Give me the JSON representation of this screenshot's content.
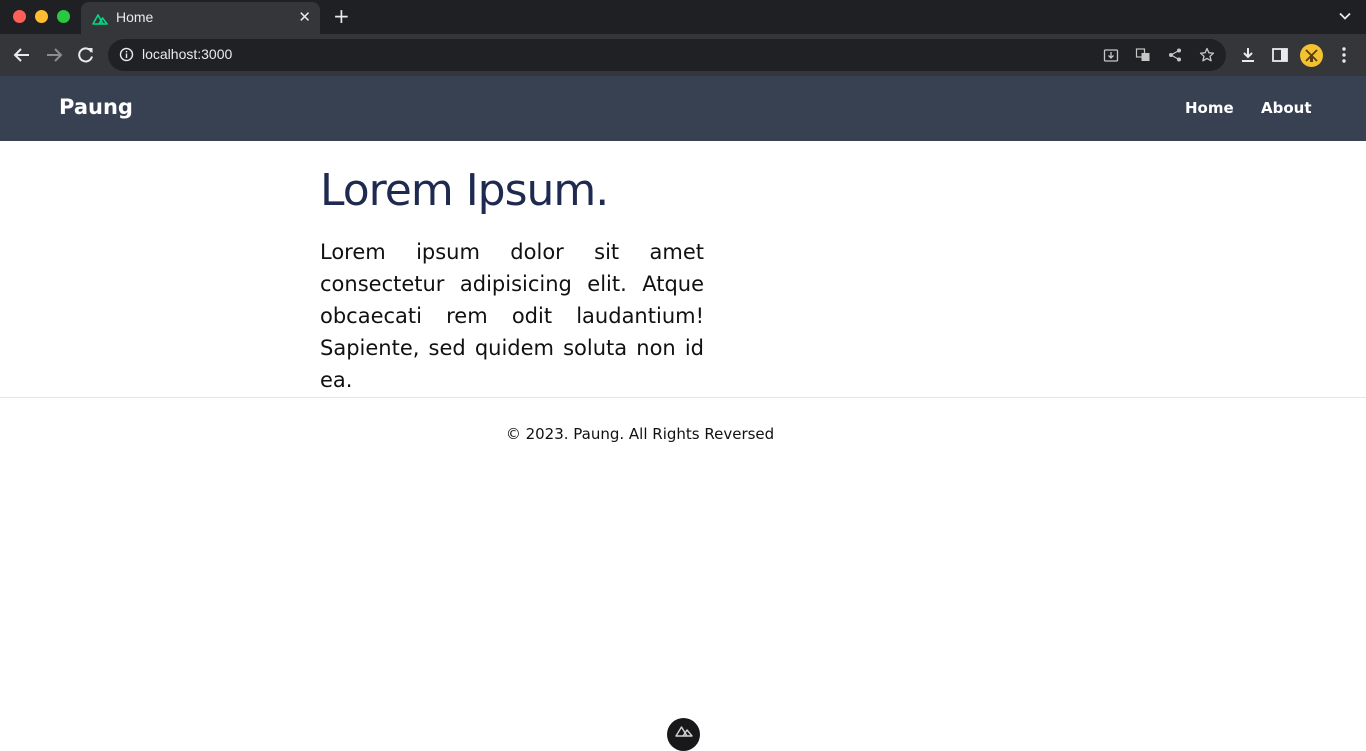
{
  "browser": {
    "tab": {
      "title": "Home",
      "favicon": "nuxt-logo-icon",
      "close_glyph": "✕"
    },
    "new_tab_glyph": "+",
    "address_bar": {
      "url": "localhost:3000"
    },
    "toolbar_icons": [
      "back-arrow-icon",
      "forward-arrow-icon",
      "reload-icon",
      "site-info-icon",
      "install-app-icon",
      "translate-icon",
      "share-icon",
      "bookmark-star-icon",
      "downloads-icon",
      "side-panel-icon",
      "profile-avatar",
      "kebab-menu-icon"
    ]
  },
  "site": {
    "brand": "Paung",
    "nav": [
      {
        "label": "Home"
      },
      {
        "label": "About"
      }
    ],
    "colors": {
      "navbar": "#374151",
      "heading": "#1e2a4f"
    }
  },
  "main": {
    "heading": "Lorem Ipsum.",
    "paragraph": "Lorem ipsum dolor sit amet consectetur adipisicing elit. Atque obcaecati rem odit laudantium! Sapiente, sed quidem soluta non id ea."
  },
  "footer": {
    "text": "© 2023. Paung. All Rights Reversed"
  }
}
